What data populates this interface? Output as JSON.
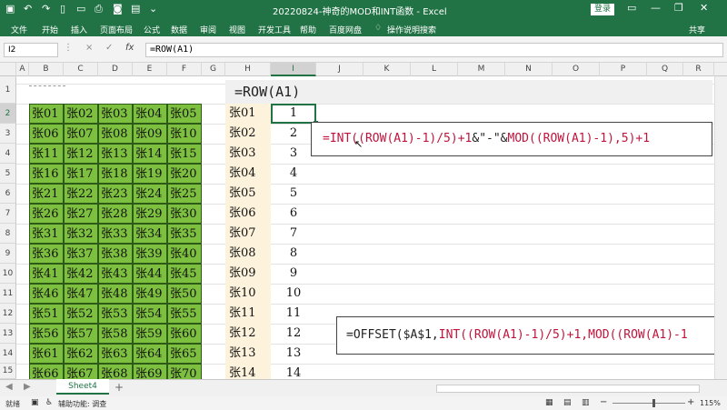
{
  "titlebar": {
    "file": "文件",
    "doc_title": "20220824-神奇的MOD和INT函数 - Excel",
    "login": "登录",
    "icons": [
      "save-icon",
      "undo-icon",
      "redo-icon",
      "new-icon",
      "open-icon",
      "print-icon",
      "camera-icon",
      "photo-icon",
      "share-icon"
    ]
  },
  "ribbon": {
    "tabs": [
      "文件",
      "开始",
      "插入",
      "页面布局",
      "公式",
      "数据",
      "审阅",
      "视图",
      "开发工具",
      "帮助",
      "百度网盘",
      "操作说明搜索"
    ],
    "share": "共享"
  },
  "formula_bar": {
    "namebox": "I2",
    "cancel": "×",
    "enter": "✓",
    "fx": "fx",
    "content": "=ROW(A1)"
  },
  "columns": [
    "A",
    "B",
    "C",
    "D",
    "E",
    "F",
    "G",
    "H",
    "I",
    "J",
    "K",
    "L",
    "M",
    "N",
    "O",
    "P",
    "Q",
    "R"
  ],
  "rows": [
    "1",
    "2",
    "3",
    "4",
    "5",
    "6",
    "7",
    "8",
    "9",
    "10",
    "11",
    "12",
    "13",
    "14",
    "15"
  ],
  "banner_text": "=ROW(A1)",
  "green_grid": [
    [
      "张01",
      "张02",
      "张03",
      "张04",
      "张05"
    ],
    [
      "张06",
      "张07",
      "张08",
      "张09",
      "张10"
    ],
    [
      "张11",
      "张12",
      "张13",
      "张14",
      "张15"
    ],
    [
      "张16",
      "张17",
      "张18",
      "张19",
      "张20"
    ],
    [
      "张21",
      "张22",
      "张23",
      "张24",
      "张25"
    ],
    [
      "张26",
      "张27",
      "张28",
      "张29",
      "张30"
    ],
    [
      "张31",
      "张32",
      "张33",
      "张34",
      "张35"
    ],
    [
      "张36",
      "张37",
      "张38",
      "张39",
      "张40"
    ],
    [
      "张41",
      "张42",
      "张43",
      "张44",
      "张45"
    ],
    [
      "张46",
      "张47",
      "张48",
      "张49",
      "张50"
    ],
    [
      "张51",
      "张52",
      "张53",
      "张54",
      "张55"
    ],
    [
      "张56",
      "张57",
      "张58",
      "张59",
      "张60"
    ],
    [
      "张61",
      "张62",
      "张63",
      "张64",
      "张65"
    ],
    [
      "张66",
      "张67",
      "张68",
      "张69",
      "张70"
    ]
  ],
  "h_column": [
    "张01",
    "张02",
    "张03",
    "张04",
    "张05",
    "张06",
    "张07",
    "张08",
    "张09",
    "张10",
    "张11",
    "张12",
    "张13",
    "张14"
  ],
  "i_column": [
    "1",
    "2",
    "3",
    "4",
    "5",
    "6",
    "7",
    "8",
    "9",
    "10",
    "11",
    "12",
    "13",
    "14"
  ],
  "callout1": {
    "parts": [
      "=INT(",
      "(ROW(A1)-1)/5)+1",
      "&\"-\"&",
      "MOD((ROW(A1)-1),5)+1"
    ]
  },
  "callout2": {
    "parts": [
      "=OFFSET($A$1,",
      "INT((ROW(A1)-1)/5)+1",
      ",MOD((ROW(A1)-1"
    ]
  },
  "sheet": {
    "tab": "Sheet4",
    "add": "+"
  },
  "status": {
    "mode": "就绪",
    "accessibility": "辅助功能: 调查",
    "zoom": "115%"
  },
  "colors": {
    "excel_green": "#217346",
    "cell_green": "#7dc040",
    "h_fill": "#fdf3dc",
    "formula_red": "#c0143c"
  }
}
